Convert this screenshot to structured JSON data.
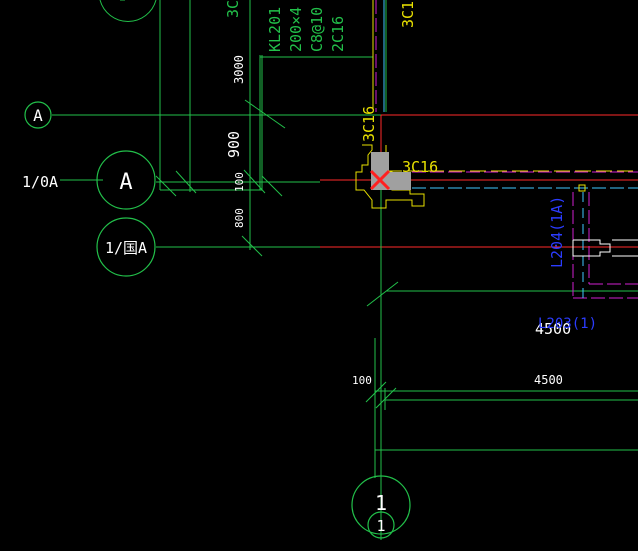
{
  "drawing": {
    "background": "#000000",
    "colors": {
      "axis": "#ff2a2a",
      "dimension": "#22c04a",
      "beam": "#e8e000",
      "hidden_beam": "#d020d0",
      "blue_label": "#2b3cff",
      "column": "#a0a0a0",
      "marker": "#ff2020"
    },
    "axis_bubbles": [
      {
        "id": "A-small",
        "label": "A"
      },
      {
        "id": "1/0A-plain",
        "label": "1/0A"
      },
      {
        "id": "A-large",
        "label": "A"
      },
      {
        "id": "1/0A-large",
        "label": "1/国A"
      },
      {
        "id": "1-bottom",
        "label": "1"
      },
      {
        "id": "1-bottom-small",
        "label": "1"
      }
    ],
    "beam_tag": {
      "lines": [
        "KL201",
        "200×4",
        "C8@10",
        "2C16"
      ],
      "top_clip_left": "3C",
      "top_clip_right": "3C1"
    },
    "dimensions": {
      "v_3000": "3000",
      "v_900": "900",
      "v_100": "100",
      "v_800": "800",
      "h_100": "100",
      "h_4500_upper": "4500",
      "h_4500_lower": "4500"
    },
    "rebar": {
      "vertical": "3C16",
      "horizontal": "3C16"
    },
    "blue_labels": {
      "beam_vertical": "L204(1A)",
      "beam_horizontal": "L203(1)"
    }
  }
}
